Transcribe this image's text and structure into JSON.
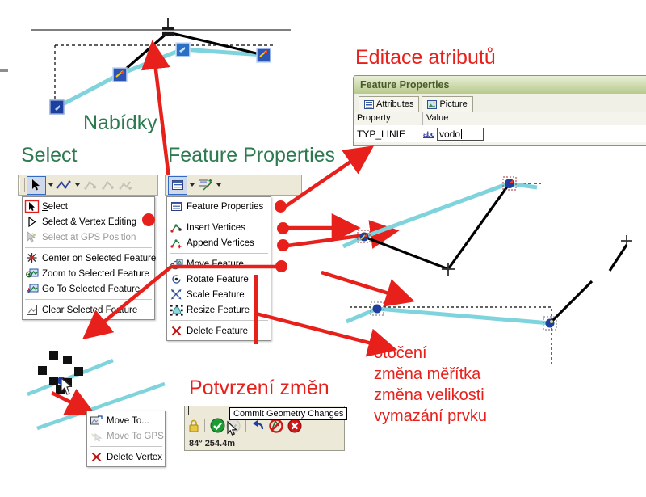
{
  "annotations": {
    "nabidky": "Nabídky",
    "select": "Select",
    "feature_properties": "Feature Properties",
    "editace_atributu": "Editace atributů",
    "potvrzeni_zmen": "Potvrzení změn",
    "right_notes": [
      "otočení",
      "změna měřítka",
      "změna velikosti",
      "vymazání prvku"
    ]
  },
  "colors": {
    "green_heading": "#2c7a4f",
    "red_heading": "#e8201b",
    "red_arrow": "#e8201b",
    "line_cyan": "#7fd3dc",
    "line_black": "#000000",
    "vertex_blue": "#1f3f9e",
    "toolbar_bg": "#ece9d8"
  },
  "select_toolbar": {
    "buttons": [
      {
        "name": "select-arrow-tool",
        "icon": "cursor-arrow-icon",
        "pressed": true
      },
      {
        "name": "select-dropdown-1",
        "icon": "chevron-down-icon"
      },
      {
        "name": "sketch-line-tool",
        "icon": "polyline-icon"
      },
      {
        "name": "select-dropdown-2",
        "icon": "chevron-down-icon"
      },
      {
        "name": "vertex-tool-1",
        "icon": "vertex-move-icon",
        "disabled": true
      },
      {
        "name": "vertex-tool-2",
        "icon": "vertex-insert-icon",
        "disabled": true
      },
      {
        "name": "vertex-tool-3",
        "icon": "vertex-append-icon",
        "disabled": true
      }
    ]
  },
  "select_menu": {
    "items": [
      {
        "label": "Select",
        "icon": "cursor-arrow-icon",
        "underline": "S",
        "highlighted": true,
        "disabled": false
      },
      {
        "label": "Select & Vertex Editing",
        "icon": "cursor-outline-icon",
        "disabled": false
      },
      {
        "label": "Select at GPS Position",
        "icon": "gps-cursor-icon",
        "disabled": true
      },
      {
        "separator": true
      },
      {
        "label": "Center on Selected Feature",
        "icon": "center-star-icon",
        "disabled": false
      },
      {
        "label": "Zoom to Selected Feature",
        "icon": "zoom-feature-icon",
        "disabled": false
      },
      {
        "label": "Go To Selected Feature",
        "icon": "goto-feature-icon",
        "disabled": false
      },
      {
        "separator": true
      },
      {
        "label": "Clear Selected Feature",
        "icon": "clear-feature-icon",
        "disabled": false
      }
    ]
  },
  "properties_toolbar": {
    "buttons": [
      {
        "name": "feature-properties-tool",
        "icon": "properties-grid-icon",
        "pressed": true
      },
      {
        "name": "properties-dropdown-1",
        "icon": "chevron-down-icon"
      },
      {
        "name": "edit-feature-tool",
        "icon": "edit-feature-icon"
      },
      {
        "name": "properties-dropdown-2",
        "icon": "chevron-down-icon"
      }
    ]
  },
  "properties_menu": {
    "items": [
      {
        "label": "Feature Properties",
        "icon": "properties-grid-icon"
      },
      {
        "separator": true
      },
      {
        "label": "Insert Vertices",
        "icon": "insert-vertices-icon"
      },
      {
        "label": "Append Vertices",
        "icon": "append-vertices-icon"
      },
      {
        "separator": true
      },
      {
        "label": "Move Feature",
        "icon": "move-feature-icon"
      },
      {
        "label": "Rotate Feature",
        "icon": "rotate-feature-icon"
      },
      {
        "label": "Scale Feature",
        "icon": "scale-feature-icon"
      },
      {
        "label": "Resize Feature",
        "icon": "resize-feature-icon"
      },
      {
        "separator": true
      },
      {
        "label": "Delete Feature",
        "icon": "delete-x-icon"
      }
    ]
  },
  "vertex_menu": {
    "items": [
      {
        "label": "Move To...",
        "icon": "move-to-icon",
        "disabled": false
      },
      {
        "label": "Move To GPS",
        "icon": "move-to-gps-icon",
        "disabled": true
      },
      {
        "separator": true
      },
      {
        "label": "Delete Vertex",
        "icon": "delete-x-icon",
        "disabled": false
      }
    ]
  },
  "feature_properties_dialog": {
    "title": "Feature Properties",
    "tabs": [
      {
        "label": "Attributes",
        "icon": "attributes-grid-icon",
        "active": true
      },
      {
        "label": "Picture",
        "icon": "picture-icon",
        "active": false
      }
    ],
    "grid_headers": [
      "Property",
      "Value"
    ],
    "rows": [
      {
        "property": "TYP_LINIE",
        "value": "vodo",
        "type_icon": "abc-text-icon"
      }
    ]
  },
  "commit_panel": {
    "tooltip": "Commit Geometry Changes",
    "buttons": [
      {
        "name": "lock-button",
        "icon": "lock-icon"
      },
      {
        "name": "commit-button",
        "icon": "check-circle-green-icon"
      },
      {
        "name": "commit-dropdown",
        "icon": "chevron-down-circle-icon",
        "disabled": true
      },
      {
        "name": "undo-button",
        "icon": "undo-arrow-icon"
      },
      {
        "name": "discard-button",
        "icon": "cancel-circle-icon"
      },
      {
        "name": "delete-button",
        "icon": "close-circle-red-icon"
      }
    ],
    "status": "84° 254.4m"
  }
}
